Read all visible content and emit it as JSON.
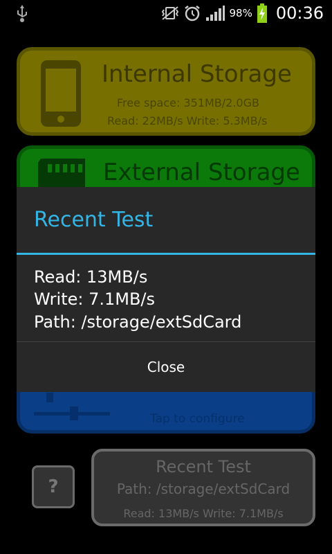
{
  "status_bar": {
    "battery_percent": "98%",
    "time": "00:36"
  },
  "internal_card": {
    "title": "Internal Storage",
    "free_space": "Free space: 351MB/2.0GB",
    "speeds": "Read: 22MB/s Write: 5.3MB/s"
  },
  "external_card": {
    "title": "External Storage"
  },
  "config_card": {
    "hint": "Tap to configure"
  },
  "dialog": {
    "title": "Recent Test",
    "read": "Read: 13MB/s",
    "write": "Write: 7.1MB/s",
    "path": "Path: /storage/extSdCard",
    "close_label": "Close"
  },
  "bottom": {
    "help_label": "?",
    "recent_title": "Recent Test",
    "recent_path": "Path: /storage/extSdCard",
    "recent_speeds": "Read: 13MB/s Write: 7.1MB/s"
  },
  "colors": {
    "accent": "#33b5e5",
    "internal": "#777000",
    "external": "#0b7a0b",
    "config": "#0a3f87"
  }
}
